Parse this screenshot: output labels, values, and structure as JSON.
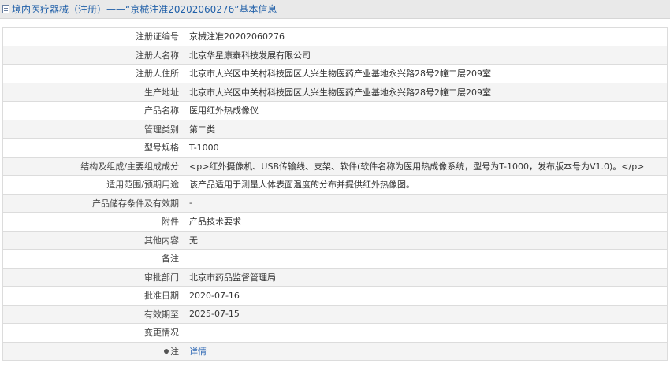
{
  "header": {
    "title": "境内医疗器械（注册）——“京械注准20202060276”基本信息",
    "icon": "document-icon"
  },
  "rows": [
    {
      "label": "注册证编号",
      "value": "京械注准20202060276"
    },
    {
      "label": "注册人名称",
      "value": "北京华星康泰科技发展有限公司"
    },
    {
      "label": "注册人住所",
      "value": "北京市大兴区中关村科技园区大兴生物医药产业基地永兴路28号2幢二层209室"
    },
    {
      "label": "生产地址",
      "value": "北京市大兴区中关村科技园区大兴生物医药产业基地永兴路28号2幢二层209室"
    },
    {
      "label": "产品名称",
      "value": "医用红外热成像仪"
    },
    {
      "label": "管理类别",
      "value": "第二类"
    },
    {
      "label": "型号规格",
      "value": "T-1000"
    },
    {
      "label": "结构及组成/主要组成成分",
      "value": "<p>红外摄像机、USB传输线、支架、软件(软件名称为医用热成像系统，型号为T-1000，发布版本号为V1.0)。</p>"
    },
    {
      "label": "适用范围/预期用途",
      "value": "该产品适用于测量人体表面温度的分布并提供红外热像图。"
    },
    {
      "label": "产品储存条件及有效期",
      "value": "-"
    },
    {
      "label": "附件",
      "value": "产品技术要求"
    },
    {
      "label": "其他内容",
      "value": "无"
    },
    {
      "label": "备注",
      "value": ""
    },
    {
      "label": "审批部门",
      "value": "北京市药品监督管理局"
    },
    {
      "label": "批准日期",
      "value": "2020-07-16"
    },
    {
      "label": "有效期至",
      "value": "2025-07-15"
    },
    {
      "label": "变更情况",
      "value": ""
    }
  ],
  "note_row": {
    "label": "注",
    "icon": "map-pin-icon",
    "link_text": "详情"
  }
}
